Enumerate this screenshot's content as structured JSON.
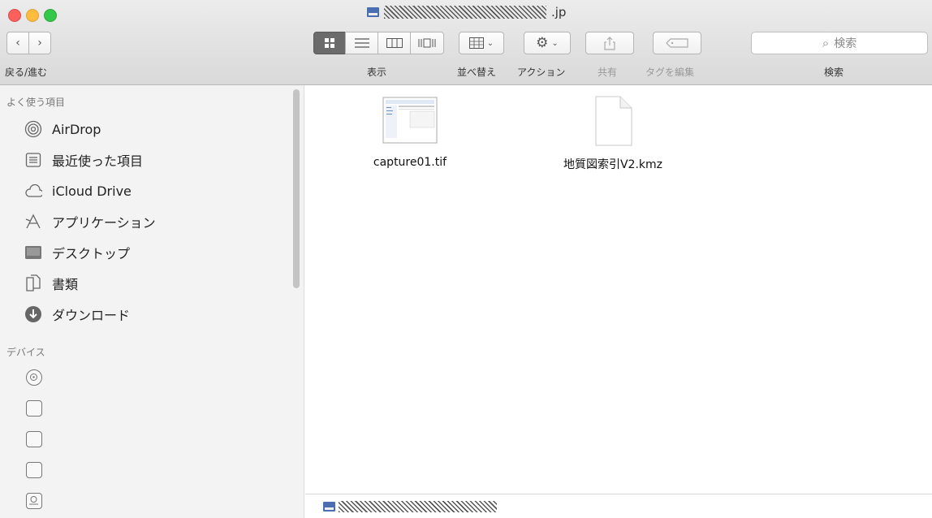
{
  "window": {
    "title_suffix": ".jp"
  },
  "toolbar": {
    "back_forward_label": "戻る/進む",
    "view_label": "表示",
    "arrange_label": "並べ替え",
    "action_label": "アクション",
    "share_label": "共有",
    "tags_label": "タグを編集",
    "search_label": "検索",
    "search_placeholder": "検索"
  },
  "sidebar": {
    "favorites_header": "よく使う項目",
    "favorites": [
      {
        "label": "AirDrop",
        "icon": "airdrop-icon"
      },
      {
        "label": "最近使った項目",
        "icon": "recents-icon"
      },
      {
        "label": "iCloud Drive",
        "icon": "cloud-icon"
      },
      {
        "label": "アプリケーション",
        "icon": "applications-icon"
      },
      {
        "label": "デスクトップ",
        "icon": "desktop-icon"
      },
      {
        "label": "書類",
        "icon": "documents-icon"
      },
      {
        "label": "ダウンロード",
        "icon": "download-icon"
      }
    ],
    "devices_header": "デバイス",
    "devices": [
      "optical-disc-icon",
      "drive-icon",
      "drive-icon",
      "drive-icon",
      "server-drive-icon"
    ]
  },
  "files": [
    {
      "name": "capture01.tif",
      "icon": "image-thumbnail-icon"
    },
    {
      "name": "地質図索引V2.kmz",
      "icon": "document-icon"
    }
  ]
}
